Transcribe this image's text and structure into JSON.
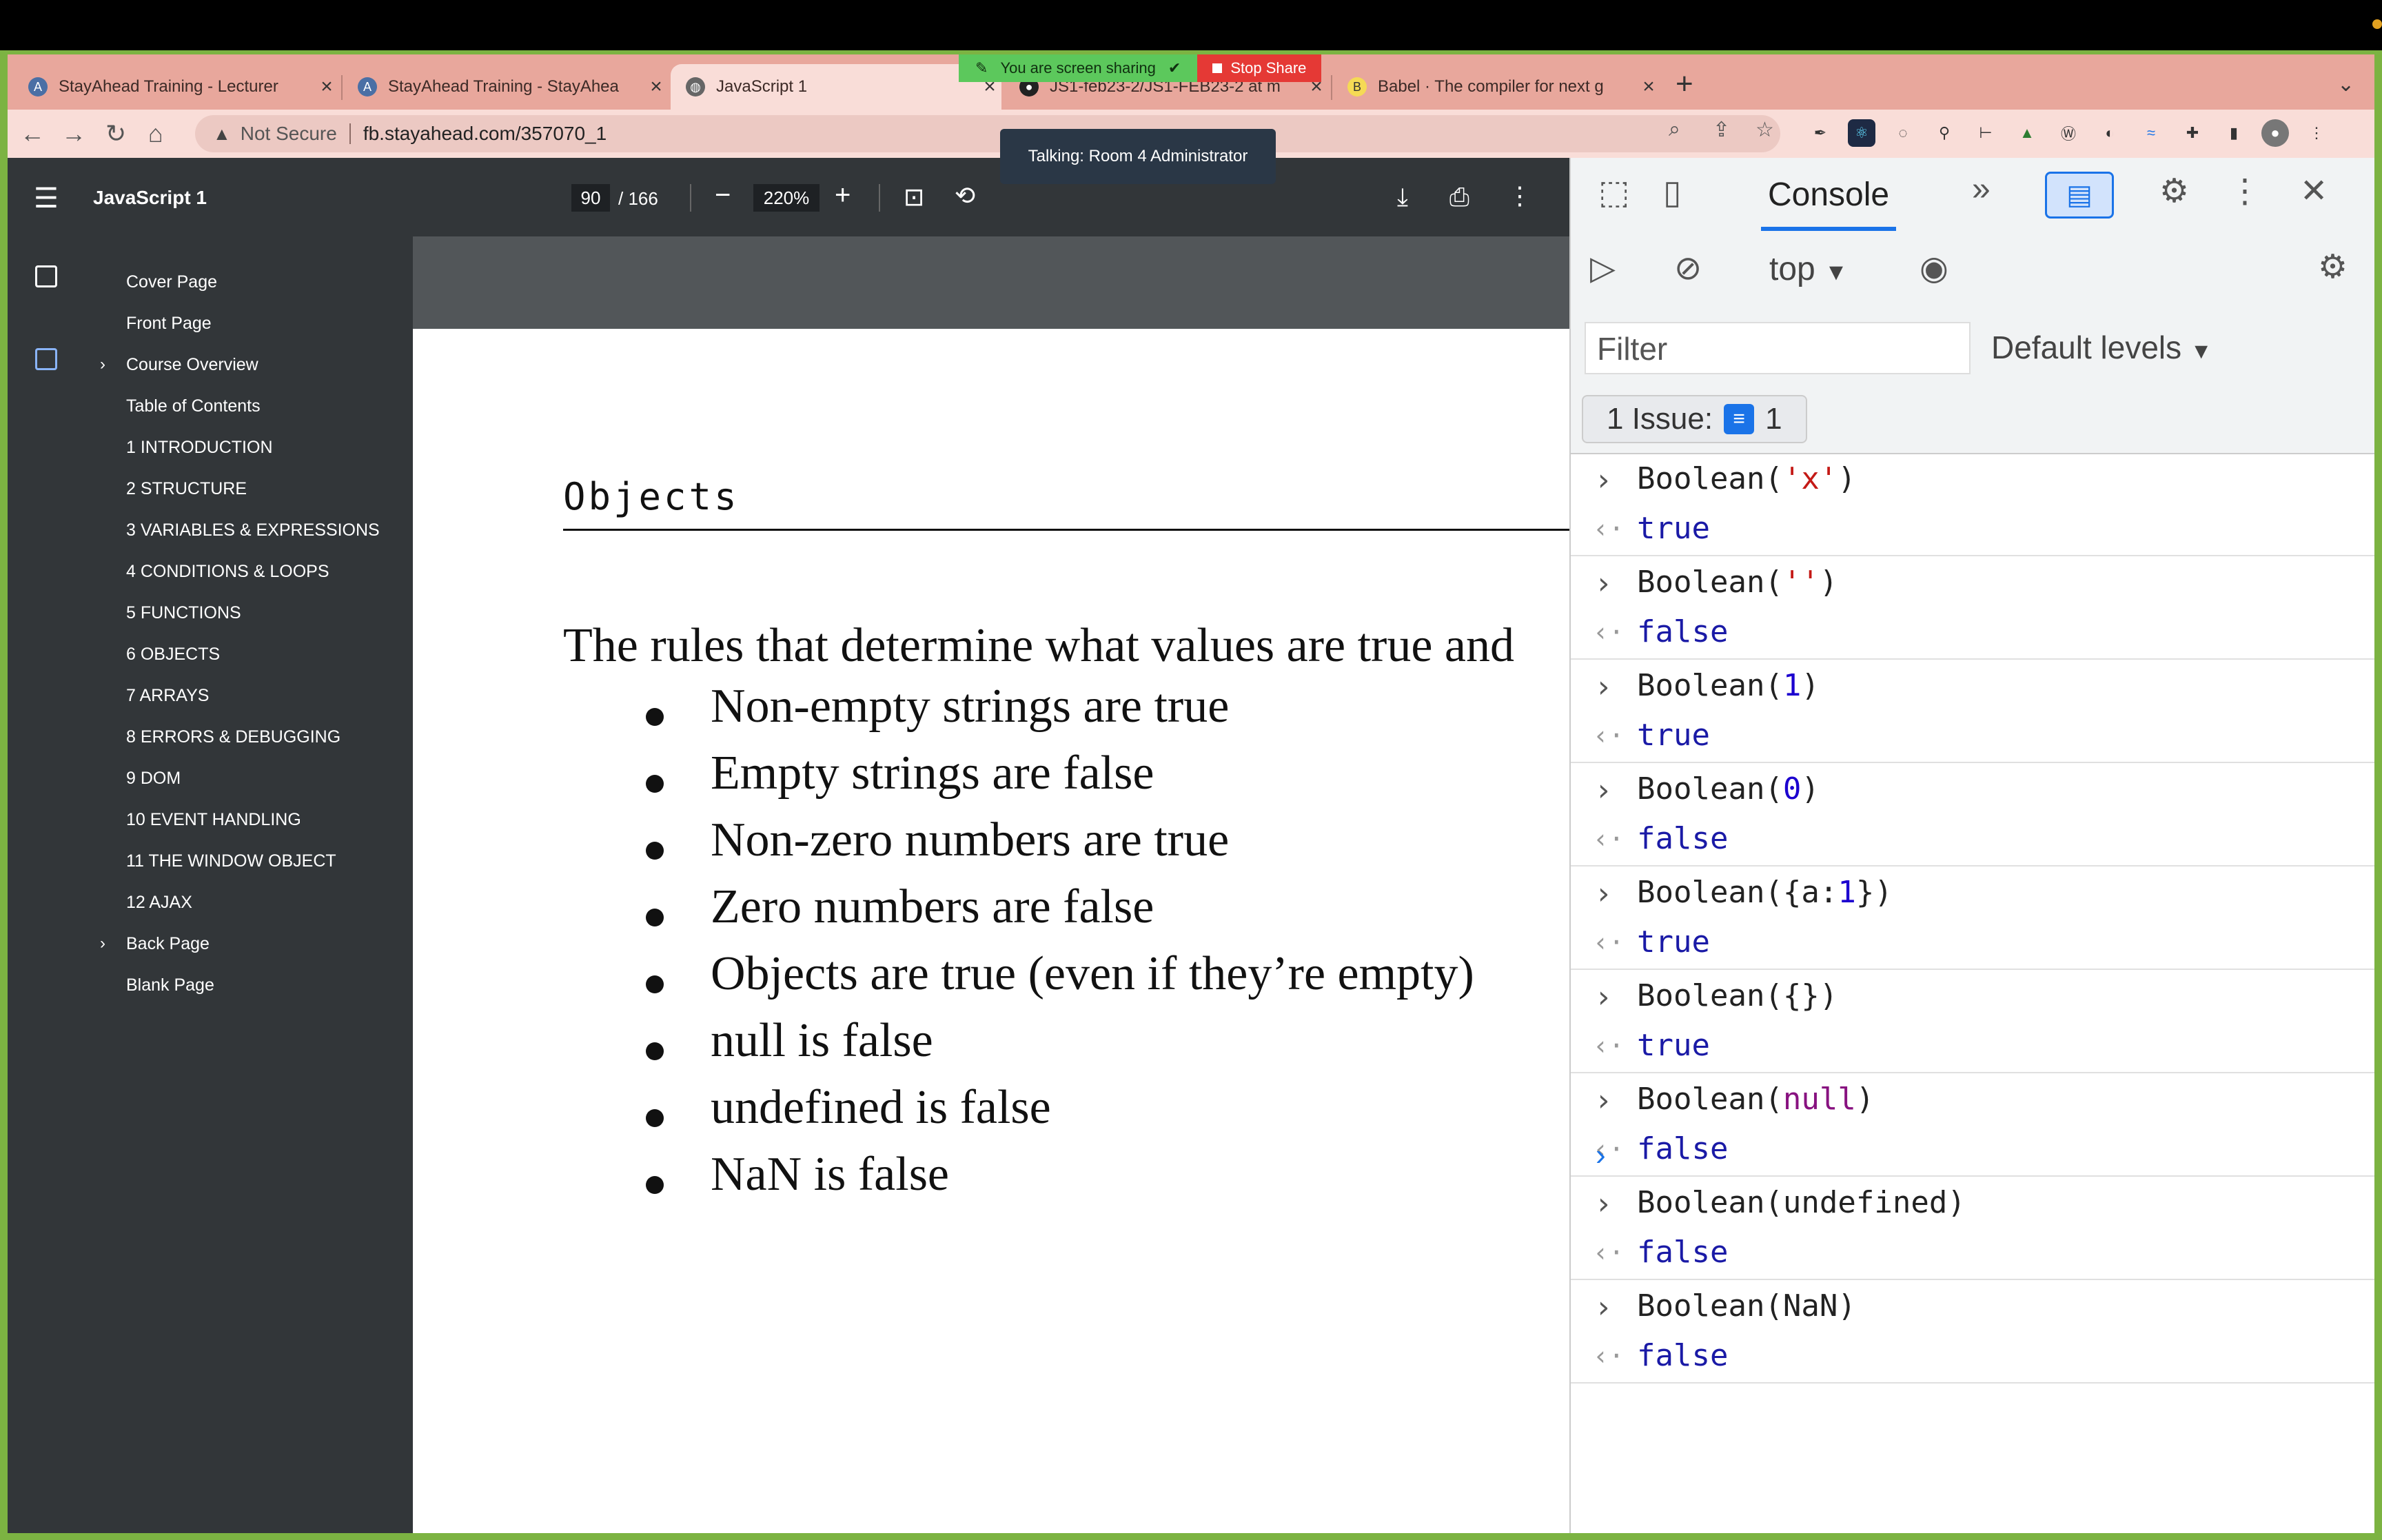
{
  "tabs": [
    {
      "title": "StayAhead Training - Lecturer ",
      "active": false
    },
    {
      "title": "StayAhead Training - StayAhea",
      "active": false
    },
    {
      "title": "JavaScript 1",
      "active": true
    },
    {
      "title": "JS1-feb23-2/JS1-FEB23-2 at m",
      "active": false
    },
    {
      "title": "Babel · The compiler for next g",
      "active": false
    }
  ],
  "share_banner": {
    "message": "You are screen sharing",
    "stop_label": "Stop Share"
  },
  "toolbar": {
    "security_label": "Not Secure",
    "url": "fb.stayahead.com/357070_1"
  },
  "talking_popup": "Talking: Room 4 Administrator",
  "pdf": {
    "title": "JavaScript 1",
    "current_page": "90",
    "total_pages": "/ 166",
    "zoom": "220%"
  },
  "outline": [
    {
      "label": "Cover Page",
      "expandable": false
    },
    {
      "label": "Front Page",
      "expandable": false
    },
    {
      "label": "Course Overview",
      "expandable": true
    },
    {
      "label": "Table of Contents",
      "expandable": false
    },
    {
      "label": "1 INTRODUCTION",
      "expandable": false
    },
    {
      "label": "2 STRUCTURE",
      "expandable": false
    },
    {
      "label": "3 VARIABLES & EXPRESSIONS",
      "expandable": false
    },
    {
      "label": "4 CONDITIONS & LOOPS",
      "expandable": false
    },
    {
      "label": "5 FUNCTIONS",
      "expandable": false
    },
    {
      "label": "6 OBJECTS",
      "expandable": false
    },
    {
      "label": "7 ARRAYS",
      "expandable": false
    },
    {
      "label": "8 ERRORS & DEBUGGING",
      "expandable": false
    },
    {
      "label": "9 DOM",
      "expandable": false
    },
    {
      "label": "10 EVENT HANDLING",
      "expandable": false
    },
    {
      "label": "11 THE WINDOW OBJECT",
      "expandable": false
    },
    {
      "label": "12 AJAX",
      "expandable": false
    },
    {
      "label": "Back Page",
      "expandable": true
    },
    {
      "label": "Blank Page",
      "expandable": false
    }
  ],
  "page_content": {
    "heading": "Objects",
    "intro": "The rules that determine what values are true and",
    "bullets": [
      "Non-empty strings are true",
      "Empty strings are false",
      "Non-zero numbers are true",
      "Zero numbers are false",
      "Objects are true (even if they’re empty)",
      "null is false",
      "undefined is false",
      "NaN is false"
    ]
  },
  "devtools": {
    "tab_label": "Console",
    "context": "top",
    "filter_placeholder": "Filter",
    "levels_label": "Default levels",
    "issues_label": "1 Issue:",
    "issues_count": "1",
    "issue_badge_count": "1",
    "entries": [
      {
        "parts": [
          [
            "Boolean(",
            "plain"
          ],
          [
            "'x'",
            "str"
          ],
          [
            ")",
            "plain"
          ]
        ],
        "result": "true"
      },
      {
        "parts": [
          [
            "Boolean(",
            "plain"
          ],
          [
            "''",
            "str"
          ],
          [
            ")",
            "plain"
          ]
        ],
        "result": "false"
      },
      {
        "parts": [
          [
            "Boolean(",
            "plain"
          ],
          [
            "1",
            "num"
          ],
          [
            ")",
            "plain"
          ]
        ],
        "result": "true"
      },
      {
        "parts": [
          [
            "Boolean(",
            "plain"
          ],
          [
            "0",
            "num"
          ],
          [
            ")",
            "plain"
          ]
        ],
        "result": "false"
      },
      {
        "parts": [
          [
            "Boolean({a:",
            "plain"
          ],
          [
            "1",
            "num"
          ],
          [
            "})",
            "plain"
          ]
        ],
        "result": "true"
      },
      {
        "parts": [
          [
            "Boolean({})",
            "plain"
          ]
        ],
        "result": "true"
      },
      {
        "parts": [
          [
            "Boolean(",
            "plain"
          ],
          [
            "null",
            "kw"
          ],
          [
            ")",
            "plain"
          ]
        ],
        "result": "false"
      },
      {
        "parts": [
          [
            "Boolean(undefined)",
            "plain"
          ]
        ],
        "result": "false"
      },
      {
        "parts": [
          [
            "Boolean(NaN)",
            "plain"
          ]
        ],
        "result": "false"
      }
    ]
  },
  "colors": {
    "frame": "#7cb342",
    "tab_strip": "#e8a79c",
    "pdf_toolbar": "#323639",
    "console_result": "#1a1aa6",
    "string": "#c41a16",
    "number": "#1c00cf",
    "keyword": "#881280",
    "accent": "#1a73e8"
  }
}
